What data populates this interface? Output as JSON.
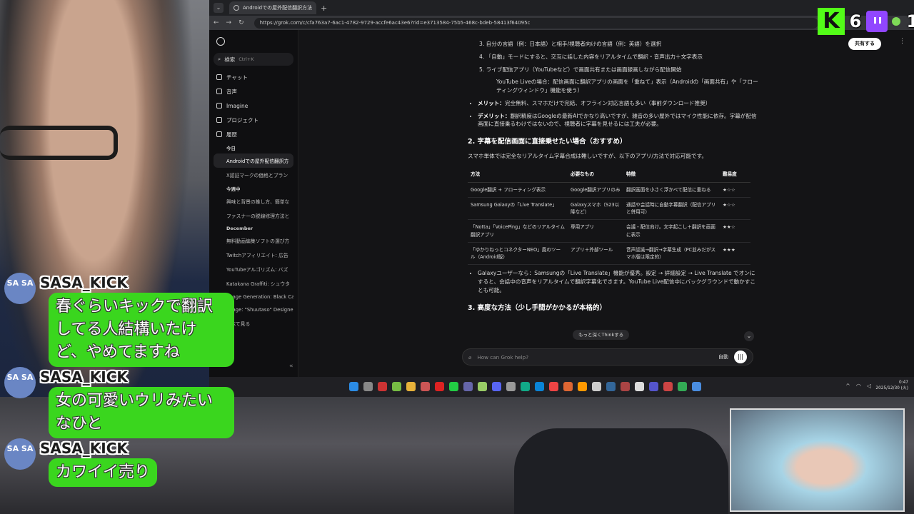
{
  "browser": {
    "tab_title": "Androidでの屋外配信翻訳方法",
    "url": "https://grok.com/c/cfa763a7-6ac1-4782-9729-accfe6ac43e6?rid=e3713584-75b5-468c-bdeb-58413f64095c"
  },
  "sidebar": {
    "search_label": "検索",
    "search_shortcut": "Ctrl+K",
    "nav": [
      "チャット",
      "音声",
      "Imagine",
      "プロジェクト",
      "履歴"
    ],
    "sections": {
      "today": "今日",
      "this_week": "今週中",
      "december": "December",
      "see_all": "すべて見る"
    },
    "history_today": [
      "Androidでの屋外配信翻訳方",
      "X認証マークの価格とプラン"
    ],
    "history_week": [
      "興味と背景の推し方、簡単な",
      "ファスナーの脱線修理方法と"
    ],
    "history_december": [
      "無料動画編集ソフトの選び方",
      "Twitchアフィリエイト: 広告",
      "YouTubeアルゴリズム: バズ",
      "Katakana Graffiti: シュウタ",
      "Image Generation: Black Ca",
      "Image: \"Shuutaso\" Designe"
    ]
  },
  "main": {
    "share_label": "共有する",
    "steps": [
      "3.  自分の言語（例：日本語）と相手/視聴者向けの言語（例：英語）を選択",
      "4.  「自動」モードにすると、交互に話した内容をリアルタイムで翻訳・音声出力＋文字表示",
      "5.  ライブ配信アプリ（YouTubeなど）で画面共有または画面録画しながら配信開始"
    ],
    "substep": "YouTube Liveの場合：配信画面に翻訳アプリの画面を「重ねて」表示（Androidの「画面共有」や「フローティングウィンドウ」機能を使う）",
    "merit_label": "メリット：",
    "merit_text": "完全無料、スマホだけで完結、オフライン対応言語も多い（事前ダウンロード推奨）",
    "demerit_label": "デメリット：",
    "demerit_text": "翻訳精度はGoogleの最新AIでかなり高いですが、雑音の多い屋外ではマイク性能に依存。字幕が配信画面に直接乗るわけではないので、視聴者に字幕を見せるには工夫が必要。",
    "section2_title": "2. 字幕を配信画面に直接乗せたい場合（おすすめ）",
    "section2_intro": "スマホ単体では完全なリアルタイム字幕合成は難しいですが、以下のアプリ/方法で対応可能です。",
    "table_headers": [
      "方法",
      "必要なもの",
      "特徴",
      "難易度"
    ],
    "table_rows": [
      [
        "Google翻訳 + フローティング表示",
        "Google翻訳アプリのみ",
        "翻訳画面を小さく浮かべて配信に重ねる",
        "★☆☆"
      ],
      [
        "Samsung Galaxyの「Live Translate」",
        "Galaxyスマホ（S23以降など）",
        "通話や会話時に自動字幕翻訳（配信アプリと併用可）",
        "★☆☆"
      ],
      [
        "「Notta」「VoicePing」などのリアルタイム翻訳アプリ",
        "専用アプリ",
        "会議・配信向け。文字起こし＋翻訳を画面に表示",
        "★★☆"
      ],
      [
        "「ゆかりねっとコネクターNEO」風のツール（Android版）",
        "アプリ＋外部ツール",
        "音声認識→翻訳→字幕生成（PC並みだがスマホ版は限定的）",
        "★★★"
      ]
    ],
    "galaxy_note": "Galaxyユーザーなら：Samsungの「Live Translate」機能が優秀。設定 → 詳細設定 → Live Translate でオンにすると、会話中の音声をリアルタイムで翻訳字幕化できます。YouTube Live配信中にバックグラウンドで動かすことも可能。",
    "section3_title": "3. 高度な方法（少し手間がかかるが本格的）",
    "think_label": "もっと深くThinkする",
    "input_placeholder": "How can Grok help?",
    "mode_label": "自動"
  },
  "taskbar": {
    "time": "0:47",
    "date": "2025/12/30 (火)"
  },
  "overlay": {
    "kick_count": "6",
    "twitch_count": "1",
    "chat": [
      {
        "user": "SASA_KICK",
        "avatar": "SA SA",
        "text": "春ぐらいキックで翻訳してる人結構いたけど、やめてますね"
      },
      {
        "user": "SASA_KICK",
        "avatar": "SA SA",
        "text": "女の可愛いウリみたいなひと"
      },
      {
        "user": "SASA_KICK",
        "avatar": "SA SA",
        "text": "カワイイ売り"
      }
    ]
  },
  "colors": {
    "kick_green": "#53fc18",
    "twitch_purple": "#9146ff",
    "bubble_green": "#3ad61e",
    "avatar_blue": "#6a86c4"
  }
}
